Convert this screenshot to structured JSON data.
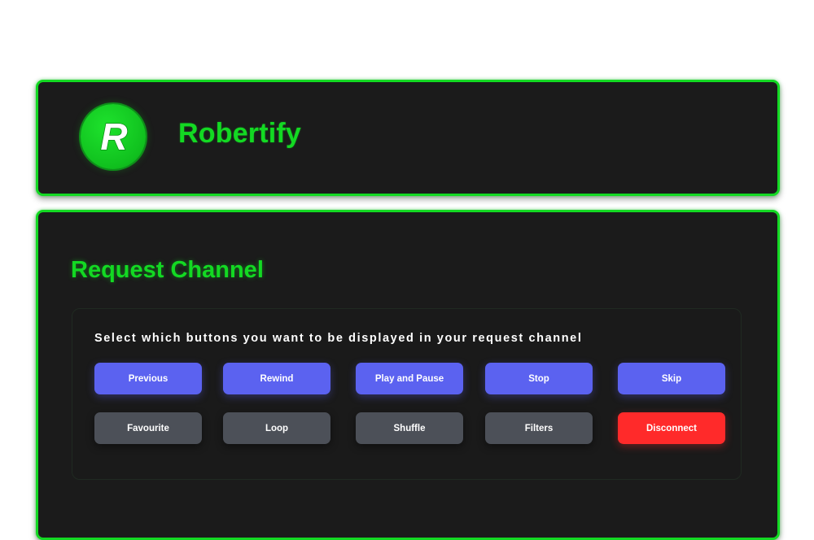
{
  "header": {
    "brand_name": "Robertify",
    "logo_letter": "R"
  },
  "request_channel": {
    "title": "Request Channel",
    "description": "Select which buttons you want to be displayed in your request channel",
    "buttons_row1": [
      {
        "label": "Previous",
        "style": "primary"
      },
      {
        "label": "Rewind",
        "style": "primary"
      },
      {
        "label": "Play and Pause",
        "style": "primary"
      },
      {
        "label": "Stop",
        "style": "primary"
      },
      {
        "label": "Skip",
        "style": "primary"
      }
    ],
    "buttons_row2": [
      {
        "label": "Favourite",
        "style": "secondary"
      },
      {
        "label": "Loop",
        "style": "secondary"
      },
      {
        "label": "Shuffle",
        "style": "secondary"
      },
      {
        "label": "Filters",
        "style": "secondary"
      },
      {
        "label": "Disconnect",
        "style": "danger"
      }
    ]
  },
  "colors": {
    "accent_green": "#13d923",
    "enabled_button": "#5b62f0",
    "disabled_button": "#4c5058",
    "danger_button": "#ff2a2a",
    "card_background": "#1b1b1b"
  }
}
